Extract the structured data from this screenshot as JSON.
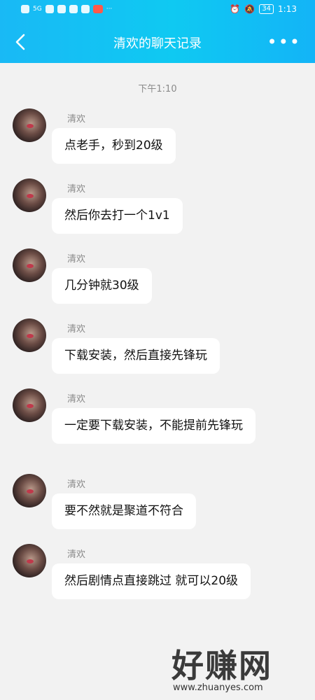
{
  "status": {
    "time": "1:13",
    "battery": "34",
    "network": "5G"
  },
  "header": {
    "title": "清欢的聊天记录",
    "more": "•••"
  },
  "timestamp": "下午1:10",
  "messages": [
    {
      "name": "清欢",
      "text": "点老手，秒到20级"
    },
    {
      "name": "清欢",
      "text": "然后你去打一个1v1"
    },
    {
      "name": "清欢",
      "text": "几分钟就30级"
    },
    {
      "name": "清欢",
      "text": "下载安装，然后直接先锋玩"
    },
    {
      "name": "清欢",
      "text": "一定要下载安装，不能提前先锋玩"
    },
    {
      "name": "清欢",
      "text": "要不然就是聚道不符合"
    },
    {
      "name": "清欢",
      "text": "然后剧情点直接跳过 就可以20级"
    }
  ],
  "watermark": {
    "text": "好赚网",
    "url": "www.zhuanyes.com"
  },
  "colors": {
    "accent": "#13b4f7"
  }
}
